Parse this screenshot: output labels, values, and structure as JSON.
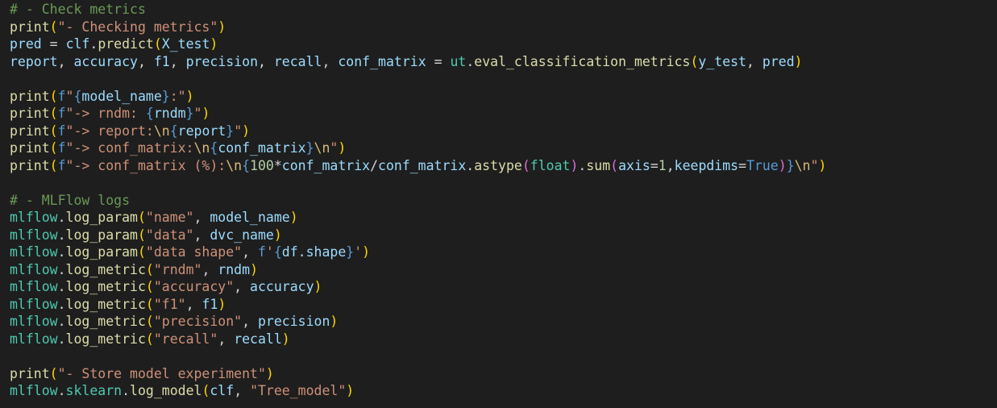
{
  "editor": {
    "background": "#1e1e1e",
    "token_colors": {
      "comment": "#6a9955",
      "builtin": "#dcdcaa",
      "string": "#ce9178",
      "variable": "#9cdcfe",
      "type": "#4ec9b0",
      "plain": "#d4d4d4",
      "keyword": "#569cd6",
      "number": "#b5cea8",
      "escape": "#d7ba7d",
      "prefix": "#569cd6",
      "bracket": "#ffd700",
      "bracket2": "#da70d6",
      "bracket3": "#179fff"
    },
    "lines": [
      [
        {
          "t": "# - Check metrics",
          "c": "comment"
        }
      ],
      [
        {
          "t": "print",
          "c": "builtin"
        },
        {
          "t": "(",
          "c": "bracket"
        },
        {
          "t": "\"- Checking metrics\"",
          "c": "string"
        },
        {
          "t": ")",
          "c": "bracket"
        }
      ],
      [
        {
          "t": "pred",
          "c": "variable"
        },
        {
          "t": " = ",
          "c": "plain"
        },
        {
          "t": "clf",
          "c": "variable"
        },
        {
          "t": ".",
          "c": "plain"
        },
        {
          "t": "predict",
          "c": "builtin"
        },
        {
          "t": "(",
          "c": "bracket"
        },
        {
          "t": "X_test",
          "c": "variable"
        },
        {
          "t": ")",
          "c": "bracket"
        }
      ],
      [
        {
          "t": "report",
          "c": "variable"
        },
        {
          "t": ", ",
          "c": "plain"
        },
        {
          "t": "accuracy",
          "c": "variable"
        },
        {
          "t": ", ",
          "c": "plain"
        },
        {
          "t": "f1",
          "c": "variable"
        },
        {
          "t": ", ",
          "c": "plain"
        },
        {
          "t": "precision",
          "c": "variable"
        },
        {
          "t": ", ",
          "c": "plain"
        },
        {
          "t": "recall",
          "c": "variable"
        },
        {
          "t": ", ",
          "c": "plain"
        },
        {
          "t": "conf_matrix",
          "c": "variable"
        },
        {
          "t": " = ",
          "c": "plain"
        },
        {
          "t": "ut",
          "c": "type"
        },
        {
          "t": ".",
          "c": "plain"
        },
        {
          "t": "eval_classification_metrics",
          "c": "builtin"
        },
        {
          "t": "(",
          "c": "bracket"
        },
        {
          "t": "y_test",
          "c": "variable"
        },
        {
          "t": ", ",
          "c": "plain"
        },
        {
          "t": "pred",
          "c": "variable"
        },
        {
          "t": ")",
          "c": "bracket"
        }
      ],
      [],
      [
        {
          "t": "print",
          "c": "builtin"
        },
        {
          "t": "(",
          "c": "bracket"
        },
        {
          "t": "f",
          "c": "prefix"
        },
        {
          "t": "\"",
          "c": "string"
        },
        {
          "t": "{",
          "c": "prefix"
        },
        {
          "t": "model_name",
          "c": "variable"
        },
        {
          "t": "}",
          "c": "prefix"
        },
        {
          "t": ":\"",
          "c": "string"
        },
        {
          "t": ")",
          "c": "bracket"
        }
      ],
      [
        {
          "t": "print",
          "c": "builtin"
        },
        {
          "t": "(",
          "c": "bracket"
        },
        {
          "t": "f",
          "c": "prefix"
        },
        {
          "t": "\"-> rndm: ",
          "c": "string"
        },
        {
          "t": "{",
          "c": "prefix"
        },
        {
          "t": "rndm",
          "c": "variable"
        },
        {
          "t": "}",
          "c": "prefix"
        },
        {
          "t": "\"",
          "c": "string"
        },
        {
          "t": ")",
          "c": "bracket"
        }
      ],
      [
        {
          "t": "print",
          "c": "builtin"
        },
        {
          "t": "(",
          "c": "bracket"
        },
        {
          "t": "f",
          "c": "prefix"
        },
        {
          "t": "\"-> report:",
          "c": "string"
        },
        {
          "t": "\\n",
          "c": "escape"
        },
        {
          "t": "{",
          "c": "prefix"
        },
        {
          "t": "report",
          "c": "variable"
        },
        {
          "t": "}",
          "c": "prefix"
        },
        {
          "t": "\"",
          "c": "string"
        },
        {
          "t": ")",
          "c": "bracket"
        }
      ],
      [
        {
          "t": "print",
          "c": "builtin"
        },
        {
          "t": "(",
          "c": "bracket"
        },
        {
          "t": "f",
          "c": "prefix"
        },
        {
          "t": "\"-> conf_matrix:",
          "c": "string"
        },
        {
          "t": "\\n",
          "c": "escape"
        },
        {
          "t": "{",
          "c": "prefix"
        },
        {
          "t": "conf_matrix",
          "c": "variable"
        },
        {
          "t": "}",
          "c": "prefix"
        },
        {
          "t": "\\n",
          "c": "escape"
        },
        {
          "t": "\"",
          "c": "string"
        },
        {
          "t": ")",
          "c": "bracket"
        }
      ],
      [
        {
          "t": "print",
          "c": "builtin"
        },
        {
          "t": "(",
          "c": "bracket"
        },
        {
          "t": "f",
          "c": "prefix"
        },
        {
          "t": "\"-> conf_matrix (%):",
          "c": "string"
        },
        {
          "t": "\\n",
          "c": "escape"
        },
        {
          "t": "{",
          "c": "prefix"
        },
        {
          "t": "100",
          "c": "number"
        },
        {
          "t": "*",
          "c": "plain"
        },
        {
          "t": "conf_matrix",
          "c": "variable"
        },
        {
          "t": "/",
          "c": "plain"
        },
        {
          "t": "conf_matrix",
          "c": "variable"
        },
        {
          "t": ".",
          "c": "plain"
        },
        {
          "t": "astype",
          "c": "builtin"
        },
        {
          "t": "(",
          "c": "bracket2"
        },
        {
          "t": "float",
          "c": "type"
        },
        {
          "t": ")",
          "c": "bracket2"
        },
        {
          "t": ".",
          "c": "plain"
        },
        {
          "t": "sum",
          "c": "builtin"
        },
        {
          "t": "(",
          "c": "bracket2"
        },
        {
          "t": "axis",
          "c": "variable"
        },
        {
          "t": "=",
          "c": "plain"
        },
        {
          "t": "1",
          "c": "number"
        },
        {
          "t": ",",
          "c": "plain"
        },
        {
          "t": "keepdims",
          "c": "variable"
        },
        {
          "t": "=",
          "c": "plain"
        },
        {
          "t": "True",
          "c": "keyword"
        },
        {
          "t": ")",
          "c": "bracket2"
        },
        {
          "t": "}",
          "c": "prefix"
        },
        {
          "t": "\\n",
          "c": "escape"
        },
        {
          "t": "\"",
          "c": "string"
        },
        {
          "t": ")",
          "c": "bracket"
        }
      ],
      [],
      [
        {
          "t": "# - MLFlow logs",
          "c": "comment"
        }
      ],
      [
        {
          "t": "mlflow",
          "c": "type"
        },
        {
          "t": ".",
          "c": "plain"
        },
        {
          "t": "log_param",
          "c": "builtin"
        },
        {
          "t": "(",
          "c": "bracket"
        },
        {
          "t": "\"name\"",
          "c": "string"
        },
        {
          "t": ", ",
          "c": "plain"
        },
        {
          "t": "model_name",
          "c": "variable"
        },
        {
          "t": ")",
          "c": "bracket"
        }
      ],
      [
        {
          "t": "mlflow",
          "c": "type"
        },
        {
          "t": ".",
          "c": "plain"
        },
        {
          "t": "log_param",
          "c": "builtin"
        },
        {
          "t": "(",
          "c": "bracket"
        },
        {
          "t": "\"data\"",
          "c": "string"
        },
        {
          "t": ", ",
          "c": "plain"
        },
        {
          "t": "dvc_name",
          "c": "variable"
        },
        {
          "t": ")",
          "c": "bracket"
        }
      ],
      [
        {
          "t": "mlflow",
          "c": "type"
        },
        {
          "t": ".",
          "c": "plain"
        },
        {
          "t": "log_param",
          "c": "builtin"
        },
        {
          "t": "(",
          "c": "bracket"
        },
        {
          "t": "\"data shape\"",
          "c": "string"
        },
        {
          "t": ", ",
          "c": "plain"
        },
        {
          "t": "f",
          "c": "prefix"
        },
        {
          "t": "'",
          "c": "string"
        },
        {
          "t": "{",
          "c": "prefix"
        },
        {
          "t": "df",
          "c": "variable"
        },
        {
          "t": ".",
          "c": "plain"
        },
        {
          "t": "shape",
          "c": "variable"
        },
        {
          "t": "}",
          "c": "prefix"
        },
        {
          "t": "'",
          "c": "string"
        },
        {
          "t": ")",
          "c": "bracket"
        }
      ],
      [
        {
          "t": "mlflow",
          "c": "type"
        },
        {
          "t": ".",
          "c": "plain"
        },
        {
          "t": "log_metric",
          "c": "builtin"
        },
        {
          "t": "(",
          "c": "bracket"
        },
        {
          "t": "\"rndm\"",
          "c": "string"
        },
        {
          "t": ", ",
          "c": "plain"
        },
        {
          "t": "rndm",
          "c": "variable"
        },
        {
          "t": ")",
          "c": "bracket"
        }
      ],
      [
        {
          "t": "mlflow",
          "c": "type"
        },
        {
          "t": ".",
          "c": "plain"
        },
        {
          "t": "log_metric",
          "c": "builtin"
        },
        {
          "t": "(",
          "c": "bracket"
        },
        {
          "t": "\"accuracy\"",
          "c": "string"
        },
        {
          "t": ", ",
          "c": "plain"
        },
        {
          "t": "accuracy",
          "c": "variable"
        },
        {
          "t": ")",
          "c": "bracket"
        }
      ],
      [
        {
          "t": "mlflow",
          "c": "type"
        },
        {
          "t": ".",
          "c": "plain"
        },
        {
          "t": "log_metric",
          "c": "builtin"
        },
        {
          "t": "(",
          "c": "bracket"
        },
        {
          "t": "\"f1\"",
          "c": "string"
        },
        {
          "t": ", ",
          "c": "plain"
        },
        {
          "t": "f1",
          "c": "variable"
        },
        {
          "t": ")",
          "c": "bracket"
        }
      ],
      [
        {
          "t": "mlflow",
          "c": "type"
        },
        {
          "t": ".",
          "c": "plain"
        },
        {
          "t": "log_metric",
          "c": "builtin"
        },
        {
          "t": "(",
          "c": "bracket"
        },
        {
          "t": "\"precision\"",
          "c": "string"
        },
        {
          "t": ", ",
          "c": "plain"
        },
        {
          "t": "precision",
          "c": "variable"
        },
        {
          "t": ")",
          "c": "bracket"
        }
      ],
      [
        {
          "t": "mlflow",
          "c": "type"
        },
        {
          "t": ".",
          "c": "plain"
        },
        {
          "t": "log_metric",
          "c": "builtin"
        },
        {
          "t": "(",
          "c": "bracket"
        },
        {
          "t": "\"recall\"",
          "c": "string"
        },
        {
          "t": ", ",
          "c": "plain"
        },
        {
          "t": "recall",
          "c": "variable"
        },
        {
          "t": ")",
          "c": "bracket"
        }
      ],
      [],
      [
        {
          "t": "print",
          "c": "builtin"
        },
        {
          "t": "(",
          "c": "bracket"
        },
        {
          "t": "\"- Store model experiment\"",
          "c": "string"
        },
        {
          "t": ")",
          "c": "bracket"
        }
      ],
      [
        {
          "t": "mlflow",
          "c": "type"
        },
        {
          "t": ".",
          "c": "plain"
        },
        {
          "t": "sklearn",
          "c": "type"
        },
        {
          "t": ".",
          "c": "plain"
        },
        {
          "t": "log_model",
          "c": "builtin"
        },
        {
          "t": "(",
          "c": "bracket"
        },
        {
          "t": "clf",
          "c": "variable"
        },
        {
          "t": ", ",
          "c": "plain"
        },
        {
          "t": "\"Tree_model\"",
          "c": "string"
        },
        {
          "t": ")",
          "c": "bracket"
        }
      ]
    ]
  }
}
